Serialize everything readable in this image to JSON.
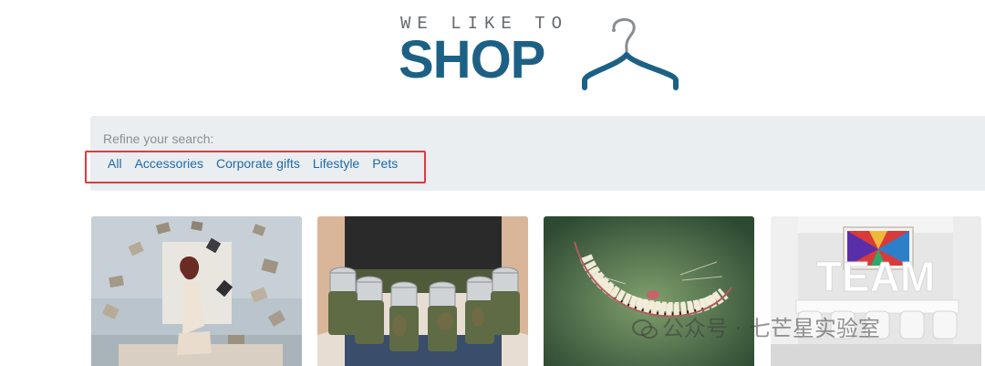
{
  "logo": {
    "tagline": "WE LIKE TO",
    "word": "SHOP",
    "icon": "hanger-icon",
    "color": "#1c6185"
  },
  "refine": {
    "label": "Refine your search:",
    "filters": [
      "All",
      "Accessories",
      "Corporate gifts",
      "Lifestyle",
      "Pets"
    ],
    "highlight_color": "#e03a3e"
  },
  "products": [
    {
      "icon": "flying-books-photo"
    },
    {
      "icon": "can-belt-photo"
    },
    {
      "icon": "cheshire-grin-photo"
    },
    {
      "icon": "team-sign-photo"
    }
  ],
  "watermark": {
    "text": "公众号 · 七芒星实验室",
    "icon": "wechat-icon"
  }
}
